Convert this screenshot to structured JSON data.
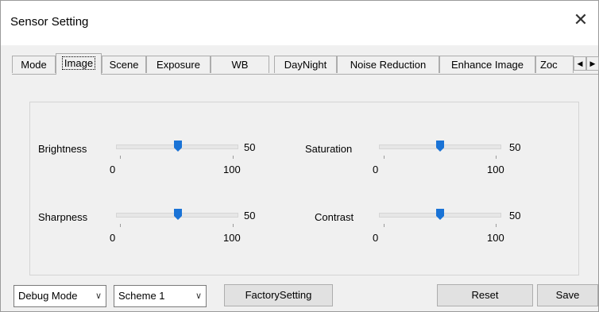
{
  "window": {
    "title": "Sensor Setting"
  },
  "tabs": [
    {
      "label": "Mode"
    },
    {
      "label": "Image"
    },
    {
      "label": "Scene"
    },
    {
      "label": "Exposure"
    },
    {
      "label": "WB"
    },
    {
      "label": "DayNight"
    },
    {
      "label": "Noise Reduction"
    },
    {
      "label": "Enhance Image"
    },
    {
      "label": "Zoc"
    }
  ],
  "active_tab": "Image",
  "sliders": {
    "brightness": {
      "label": "Brightness",
      "value": "50",
      "min": "0",
      "max": "100"
    },
    "saturation": {
      "label": "Saturation",
      "value": "50",
      "min": "0",
      "max": "100"
    },
    "sharpness": {
      "label": "Sharpness",
      "value": "50",
      "min": "0",
      "max": "100"
    },
    "contrast": {
      "label": "Contrast",
      "value": "50",
      "min": "0",
      "max": "100"
    }
  },
  "footer": {
    "mode_select": "Debug Mode",
    "scheme_select": "Scheme 1",
    "factory_button": "FactorySetting",
    "reset_button": "Reset",
    "save_button": "Save"
  },
  "colors": {
    "accent": "#1a73d6",
    "track": "#e6e6e6"
  }
}
